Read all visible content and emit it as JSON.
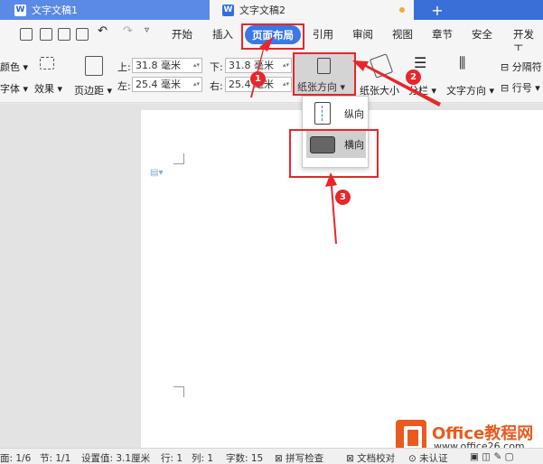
{
  "tabs": [
    {
      "title": "文字文稿1",
      "icon": "word-doc-icon"
    },
    {
      "title": "文字文稿2",
      "icon": "word-doc-icon"
    }
  ],
  "tab_add": "+",
  "menu": {
    "items": [
      "开始",
      "插入",
      "页面布局",
      "引用",
      "审阅",
      "视图",
      "章节",
      "安全",
      "开发工"
    ],
    "active": "页面布局"
  },
  "ribbon": {
    "color_label": "颜色",
    "font_label": "字体",
    "effect_label": "效果",
    "margin_label": "页边距",
    "top_label": "上:",
    "top_value": "31.8 毫米",
    "bottom_label": "下:",
    "bottom_value": "31.8 毫米",
    "left_label": "左:",
    "left_value": "25.4 毫米",
    "right_label": "右:",
    "right_value": "25.4 毫米",
    "orientation_label": "纸张方向",
    "size_label": "纸张大小",
    "columns_label": "分栏",
    "text_dir_label": "文字方向",
    "separator_label": "分隔符",
    "lineno_label": "行号"
  },
  "dropdown": {
    "portrait": "纵向",
    "landscape": "横向"
  },
  "badges": [
    "1",
    "2",
    "3"
  ],
  "statusbar": {
    "page": "面: 1/6",
    "section": "节: 1/1",
    "setting": "设置值: 3.1厘米",
    "row": "行: 1",
    "col": "列: 1",
    "words": "字数: 15",
    "spell": "拼写检查",
    "proof": "文档校对",
    "auth": "未认证"
  },
  "watermark": {
    "title": "Office教程网",
    "url": "www.office26.com"
  },
  "colors": {
    "accent": "#3a78e6",
    "highlight": "#e8262b",
    "brand": "#ea5a1e"
  }
}
